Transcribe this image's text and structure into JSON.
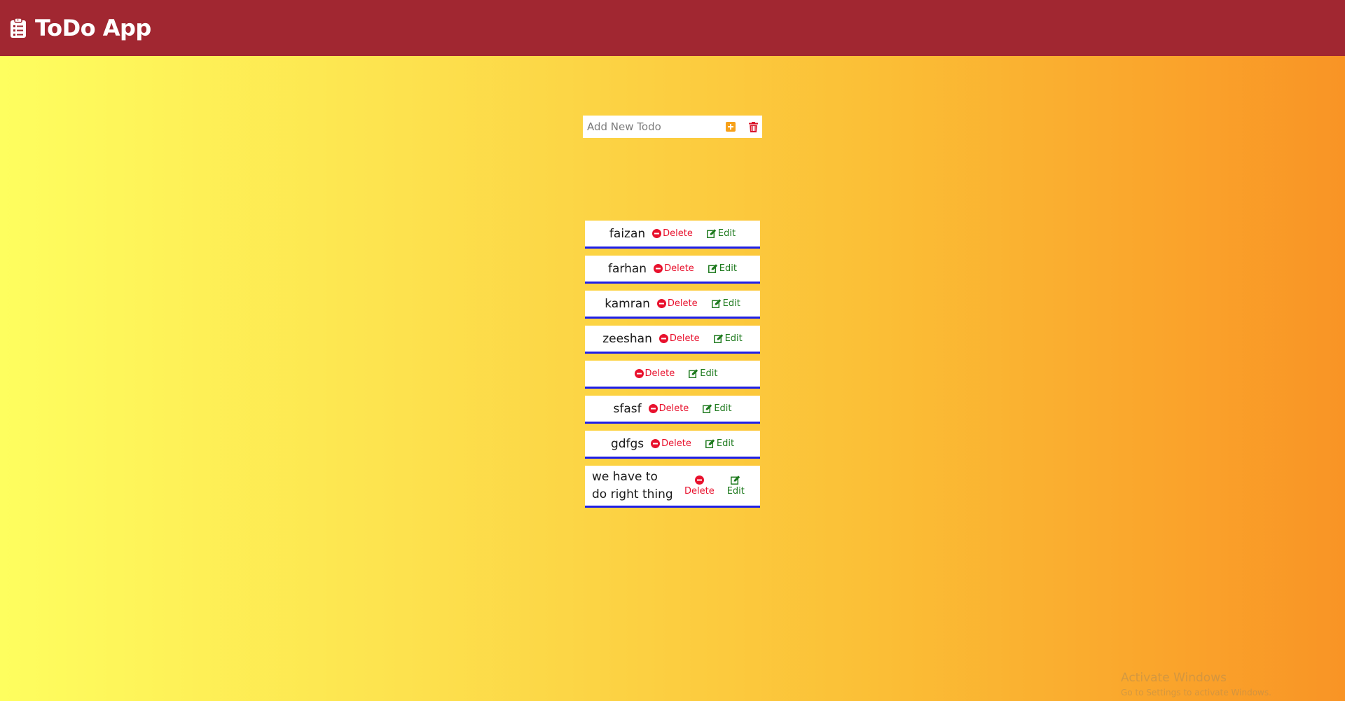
{
  "navbar": {
    "title": "ToDo App",
    "icon": "clipboard-list-icon",
    "background": "#a12731"
  },
  "add_todo": {
    "placeholder": "Add New Todo",
    "value": "",
    "add_icon": "plus-square-icon",
    "clear_icon": "trash-icon"
  },
  "todos": [
    {
      "text": "faizan",
      "delete_label": "Delete",
      "edit_label": "Edit"
    },
    {
      "text": "farhan",
      "delete_label": "Delete",
      "edit_label": "Edit"
    },
    {
      "text": "kamran",
      "delete_label": "Delete",
      "edit_label": "Edit"
    },
    {
      "text": "zeeshan",
      "delete_label": "Delete",
      "edit_label": "Edit"
    },
    {
      "text": "",
      "delete_label": "Delete",
      "edit_label": "Edit"
    },
    {
      "text": "sfasf",
      "delete_label": "Delete",
      "edit_label": "Edit"
    },
    {
      "text": "gdfgs",
      "delete_label": "Delete",
      "edit_label": "Edit"
    },
    {
      "text": "we have to do right thing",
      "delete_label": "Delete",
      "edit_label": "Edit"
    }
  ],
  "colors": {
    "delete": "#e8112d",
    "edit": "#1e7a1e",
    "item_border": "#1f1fe6",
    "add_icon": "#f7a11a",
    "clear_icon": "#d9162b"
  },
  "watermark": {
    "title": "Activate Windows",
    "subtitle": "Go to Settings to activate Windows."
  }
}
